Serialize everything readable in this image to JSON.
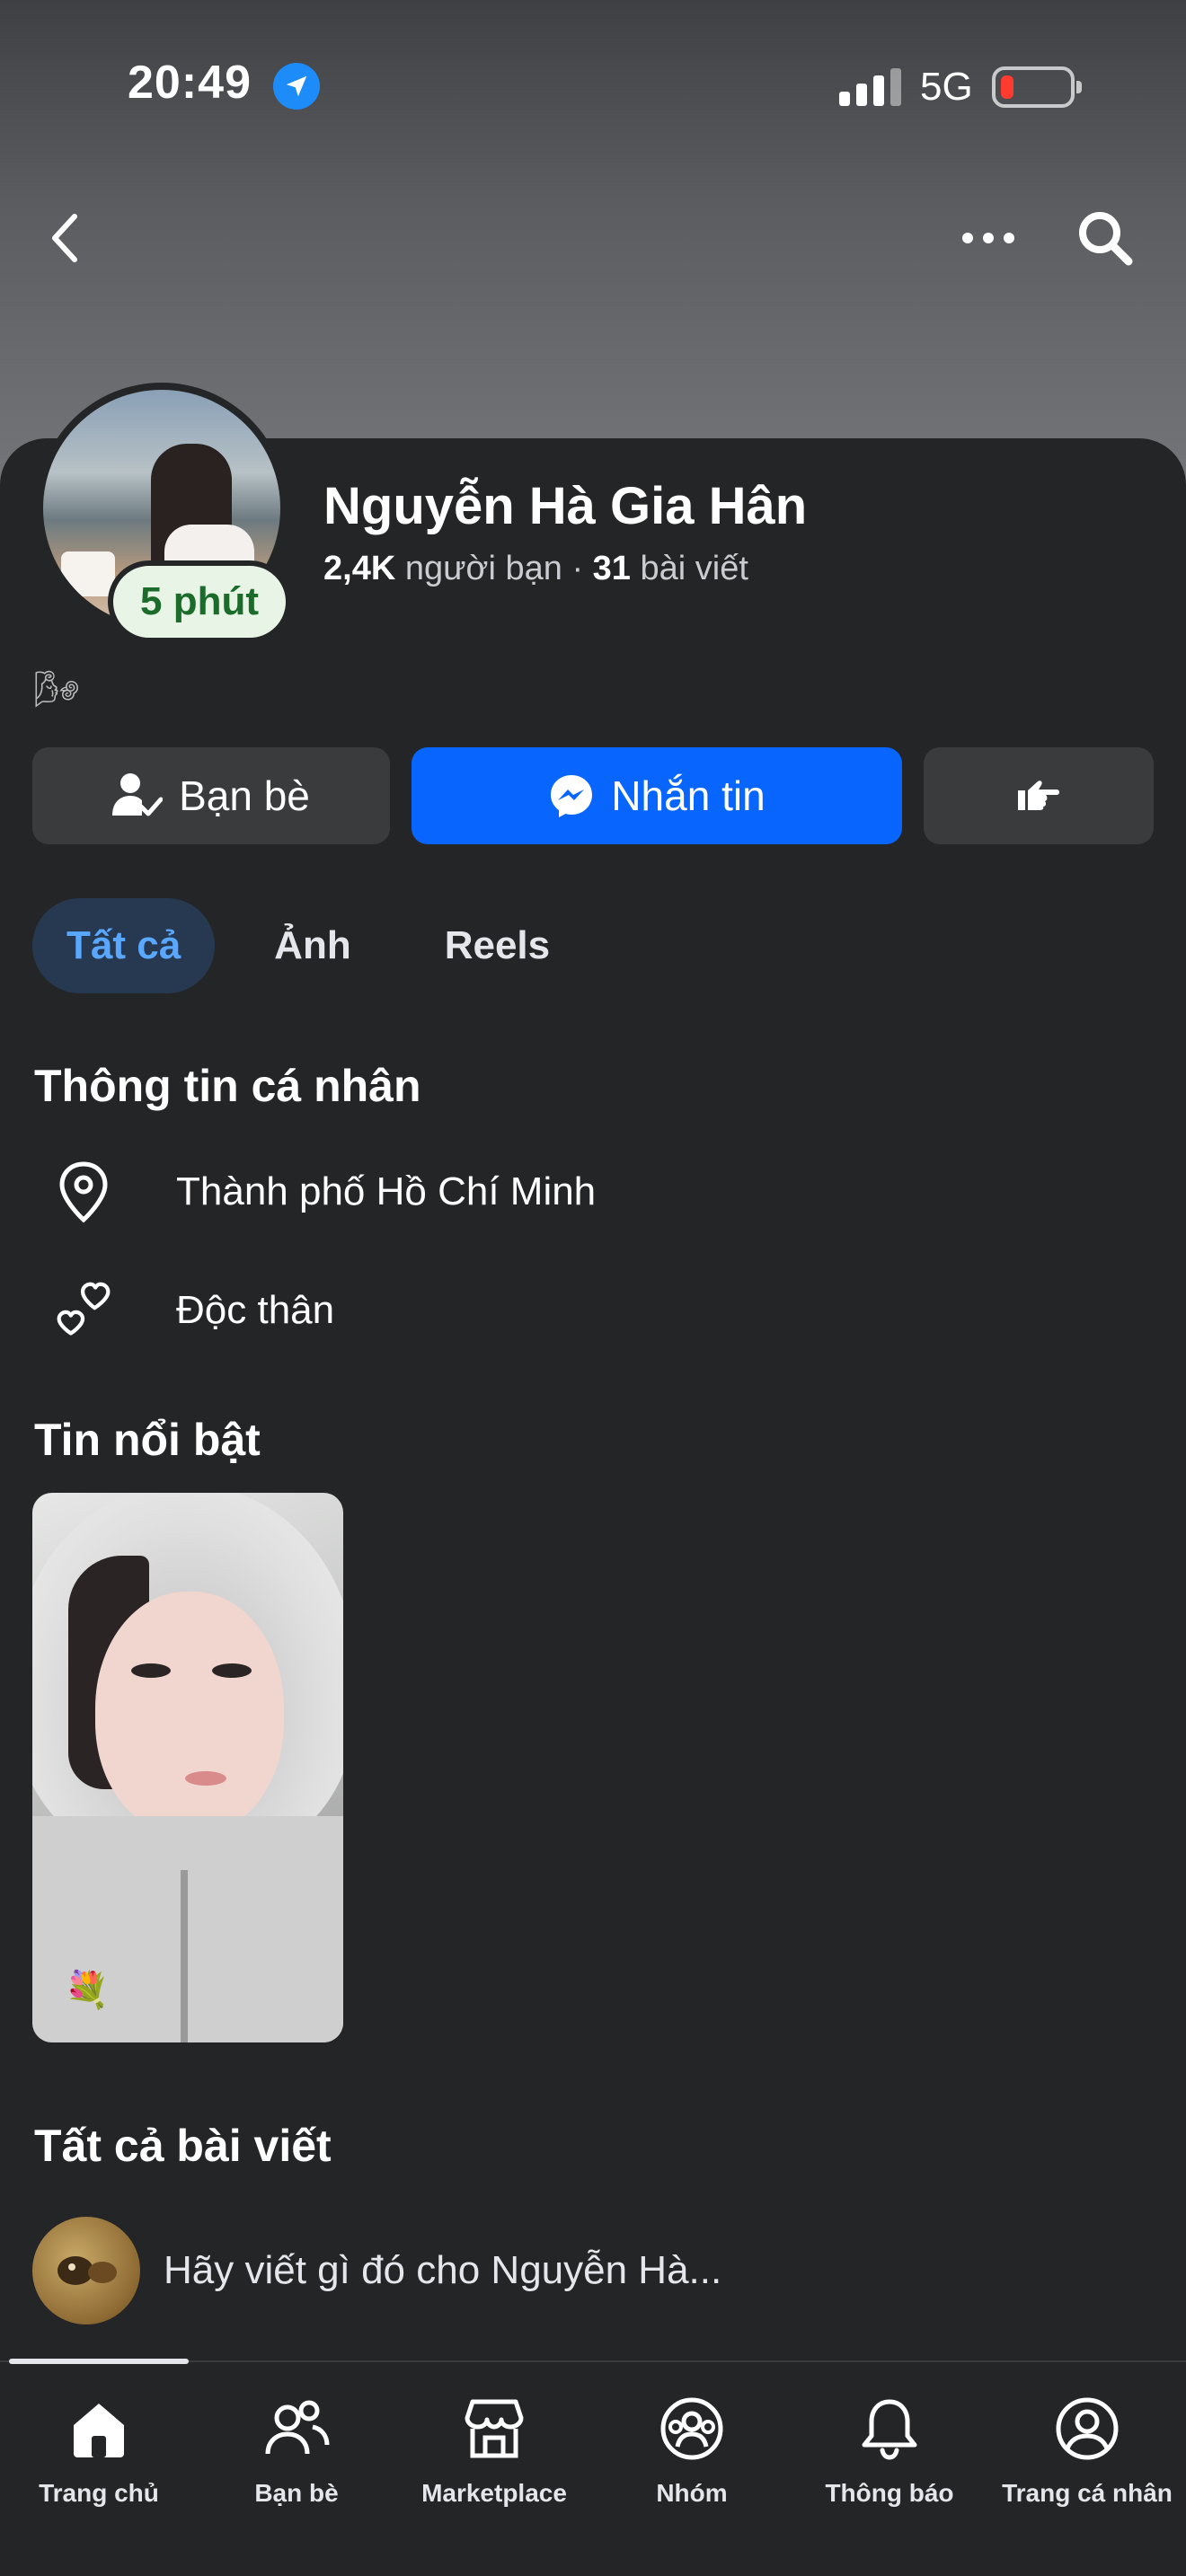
{
  "status_bar": {
    "time": "20:49",
    "network": "5G"
  },
  "profile": {
    "name": "Nguyễn Hà Gia Hân",
    "friends_count": "2,4K",
    "friends_label": "người bạn",
    "separator": "·",
    "posts_count": "31",
    "posts_label": "bài viết",
    "active_badge": "5 phút",
    "bio_emoji": "🌬"
  },
  "actions": {
    "friends_label": "Bạn bè",
    "message_label": "Nhắn tin"
  },
  "tabs": [
    {
      "label": "Tất cả",
      "active": true
    },
    {
      "label": "Ảnh",
      "active": false
    },
    {
      "label": "Reels",
      "active": false
    }
  ],
  "about": {
    "title": "Thông tin cá nhân",
    "location": "Thành phố Hồ Chí Minh",
    "relationship": "Độc thân"
  },
  "highlights": {
    "title": "Tin nổi bật",
    "emoji": "💐"
  },
  "posts": {
    "title": "Tất cả bài viết",
    "composer_placeholder": "Hãy viết gì đó cho Nguyễn Hà..."
  },
  "bottom_nav": [
    {
      "label": "Trang chủ",
      "icon": "home-icon"
    },
    {
      "label": "Bạn bè",
      "icon": "friends-icon"
    },
    {
      "label": "Marketplace",
      "icon": "marketplace-icon"
    },
    {
      "label": "Nhóm",
      "icon": "groups-icon"
    },
    {
      "label": "Thông báo",
      "icon": "bell-icon"
    },
    {
      "label": "Trang cá nhân",
      "icon": "profile-icon"
    }
  ],
  "colors": {
    "accent": "#0866ff",
    "background": "#242526",
    "active_tab_bg": "#263951",
    "active_tab_text": "#5aa7ff",
    "online_badge": "#1b6b2a"
  }
}
